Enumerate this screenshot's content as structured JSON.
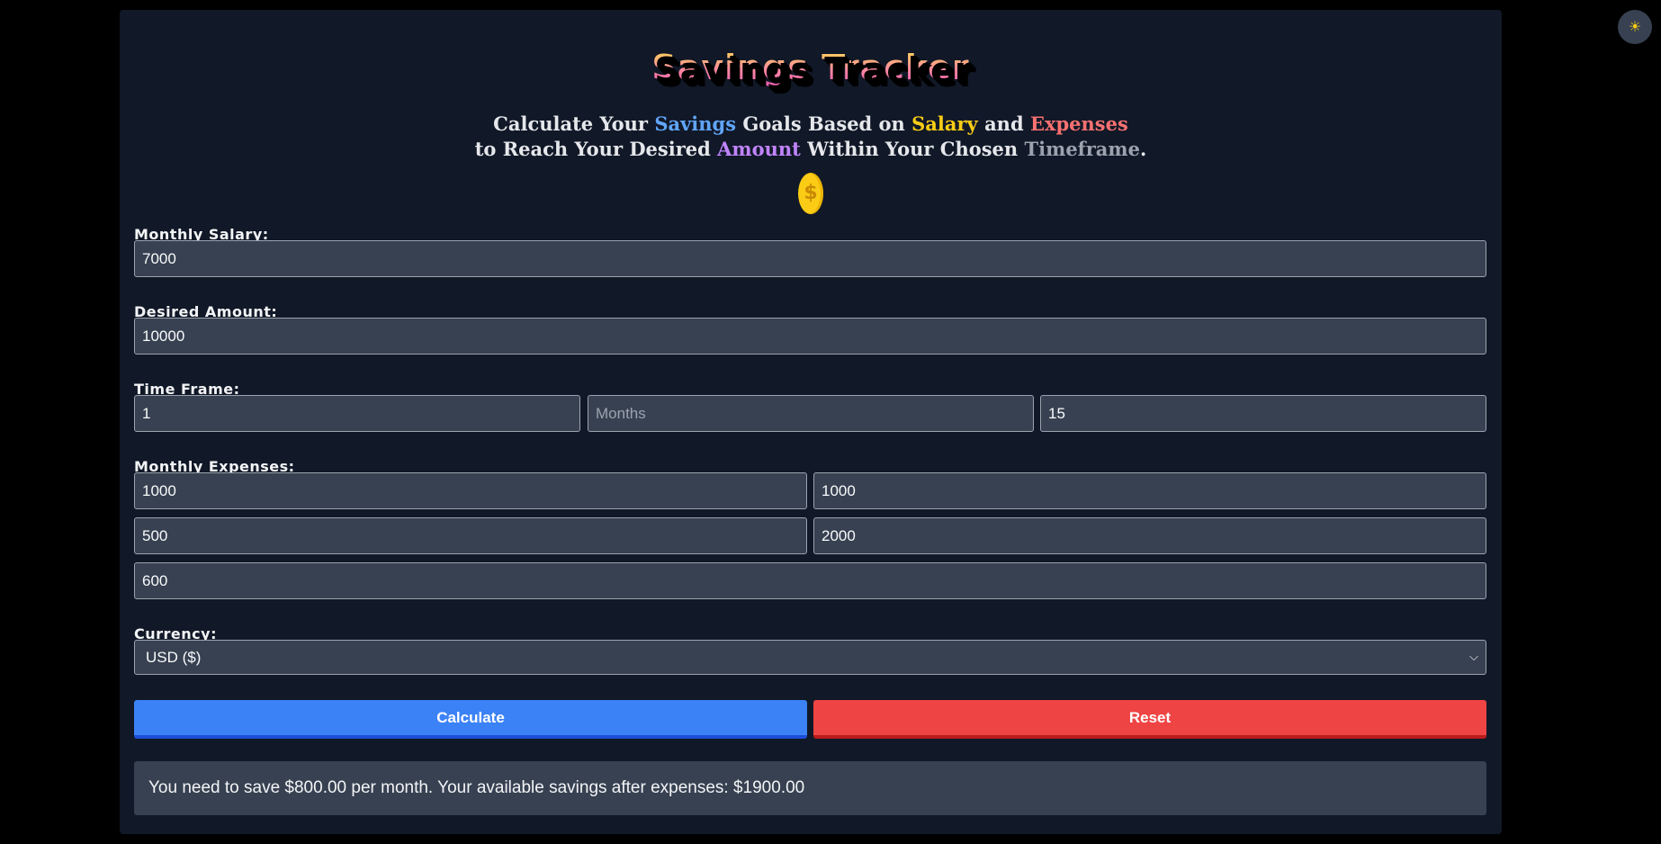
{
  "header": {
    "title": "Savings Tracker",
    "subtitle": {
      "line1": [
        {
          "text": "Calculate Your ",
          "hl": ""
        },
        {
          "text": "Savings",
          "hl": "blue"
        },
        {
          "text": " Goals Based on ",
          "hl": ""
        },
        {
          "text": "Salary",
          "hl": "yellow"
        },
        {
          "text": " and ",
          "hl": ""
        },
        {
          "text": "Expenses",
          "hl": "red"
        }
      ],
      "line2": [
        {
          "text": "to Reach Your Desired ",
          "hl": ""
        },
        {
          "text": "Amount",
          "hl": "purple"
        },
        {
          "text": " Within Your Chosen ",
          "hl": ""
        },
        {
          "text": "Timeframe",
          "hl": "gray"
        },
        {
          "text": ".",
          "hl": ""
        }
      ]
    },
    "coin_symbol": "$"
  },
  "form": {
    "salary": {
      "label": "Monthly Salary:",
      "value": "7000"
    },
    "desired": {
      "label": "Desired Amount:",
      "value": "10000"
    },
    "timeframe": {
      "label": "Time Frame:",
      "years": "1",
      "months_placeholder": "Months",
      "days": "15"
    },
    "expenses": {
      "label": "Monthly Expenses:",
      "e1": "1000",
      "e2": "1000",
      "e3": "500",
      "e4": "2000",
      "e5": "600"
    },
    "currency": {
      "label": "Currency:",
      "selected": "USD ($)"
    }
  },
  "buttons": {
    "calculate": "Calculate",
    "reset": "Reset"
  },
  "result": {
    "text": "You need to save $800.00 per month. Your available savings after expenses: $1900.00"
  },
  "theme_toggle": {
    "icon": "sun-icon",
    "glyph": "☀"
  },
  "colors": {
    "background": "#000000",
    "card": "#111827",
    "field": "#374151",
    "calculate": "#3b82f6",
    "reset": "#ef4444",
    "hl_blue": "#60a5fa",
    "hl_yellow": "#facc15",
    "hl_red": "#f87171",
    "hl_purple": "#c084fc",
    "hl_gray": "#9ca3af"
  }
}
